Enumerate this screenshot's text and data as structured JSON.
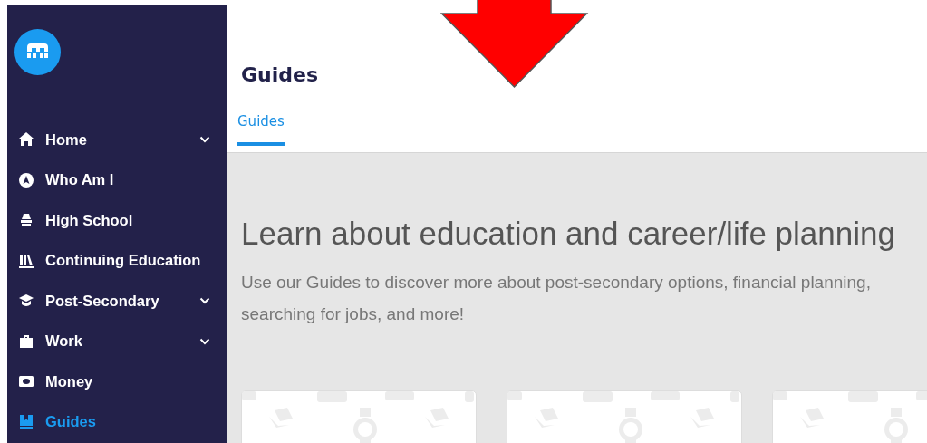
{
  "sidebar": {
    "items": [
      {
        "label": "Home",
        "expandable": true,
        "selected": false
      },
      {
        "label": "Who Am I",
        "expandable": false,
        "selected": false
      },
      {
        "label": "High School",
        "expandable": false,
        "selected": false
      },
      {
        "label": "Continuing Education",
        "expandable": false,
        "selected": false
      },
      {
        "label": "Post-Secondary",
        "expandable": true,
        "selected": false
      },
      {
        "label": "Work",
        "expandable": true,
        "selected": false
      },
      {
        "label": "Money",
        "expandable": false,
        "selected": false
      },
      {
        "label": "Guides",
        "expandable": false,
        "selected": true
      }
    ]
  },
  "page": {
    "title": "Guides",
    "tabs": [
      {
        "label": "Guides",
        "selected": true
      }
    ]
  },
  "hero": {
    "heading": "Learn about education and career/life planning",
    "text": "Use our Guides to discover more about post-secondary options, financial planning, searching for jobs, and more!"
  }
}
